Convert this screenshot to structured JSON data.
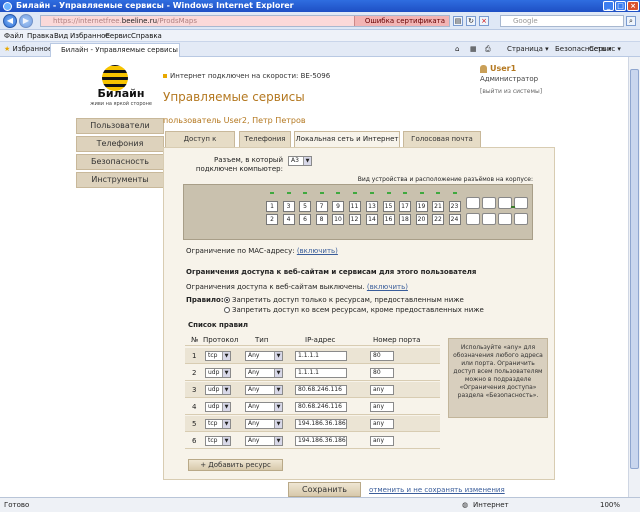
{
  "window": {
    "title": "Билайн - Управляемые сервисы - Windows Internet Explorer"
  },
  "browser": {
    "address_dim": "https://internetfree.",
    "address_host": "beeline.ru",
    "address_tail": "/ProdsMaps",
    "cert_error": "Ошибка сертификата",
    "search_placeholder": "Google",
    "menu": [
      "Файл",
      "Правка",
      "Вид",
      "Избранное",
      "Сервис",
      "Справка"
    ],
    "favorites": "Избранное",
    "tab_title": "Билайн - Управляемые сервисы",
    "tools": {
      "page": "Страница",
      "security": "Безопасность",
      "service": "Сервис"
    },
    "status_left": "Готово",
    "status_zone": "Интернет",
    "zoom": "100%"
  },
  "header": {
    "brand": "Билайн",
    "slogan": "живи на яркой стороне",
    "connection": "Интернет подключен на скорости: BE-5096",
    "title": "Управляемые сервисы",
    "user": {
      "name": "User1",
      "role": "Администратор",
      "logout": "[выйти из системы]"
    }
  },
  "nav": [
    "Пользователи",
    "Телефония",
    "Безопасность",
    "Инструменты"
  ],
  "user_label": "пользователь User2, Петр Петров",
  "tabs": [
    "Доступ к аккаунту",
    "Телефония",
    "Локальная сеть и Интернет",
    "Голосовая почта"
  ],
  "active_tab": 2,
  "port": {
    "label": "Разъем, в который подключен компьютер:",
    "value": "A3",
    "device_caption": "Вид устройства и расположение разъёмов на корпусе:",
    "top_left": [
      "1",
      "3",
      "5",
      "7",
      "9",
      "11"
    ],
    "bottom_left": [
      "2",
      "4",
      "6",
      "8",
      "10",
      "12"
    ],
    "top_right": [
      "13",
      "15",
      "17",
      "19",
      "21",
      "23"
    ],
    "bottom_right": [
      "14",
      "16",
      "18",
      "20",
      "22",
      "24"
    ]
  },
  "mac": {
    "label": "Ограничение по MAC-адресу:",
    "link": "(включить)"
  },
  "access": {
    "heading": "Ограничения доступа к веб-сайтам и сервисам для этого пользователя",
    "status": "Ограничения доступа к веб-сайтам выключены.",
    "enable_link": "(включить)",
    "rule_label": "Правило:",
    "option1": "Запретить доступ только к ресурсам, предоставленным ниже",
    "option2": "Запретить доступ ко всем ресурсам, кроме предоставленных ниже"
  },
  "rules": {
    "title": "Список правил",
    "columns": [
      "№",
      "Протокол",
      "Тип",
      "IP-адрес",
      "Номер порта"
    ],
    "rows": [
      {
        "n": "1",
        "proto": "tcp",
        "type": "Any",
        "ip": "1.1.1.1",
        "port": "80"
      },
      {
        "n": "2",
        "proto": "udp",
        "type": "Any",
        "ip": "1.1.1.1",
        "port": "80"
      },
      {
        "n": "3",
        "proto": "udp",
        "type": "Any",
        "ip": "80.68.246.116",
        "port": "any"
      },
      {
        "n": "4",
        "proto": "udp",
        "type": "Any",
        "ip": "80.68.246.116",
        "port": "any"
      },
      {
        "n": "5",
        "proto": "tcp",
        "type": "Any",
        "ip": "194.186.36.186",
        "port": "any"
      },
      {
        "n": "6",
        "proto": "tcp",
        "type": "Any",
        "ip": "194.186.36.186",
        "port": "any"
      }
    ]
  },
  "help": "Используйте «any» для обозначения любого адреса или порта. Ограничить доступ всем пользователям можно в подразделе «Ограничения доступа» раздела «Безопасность».",
  "add_button": "+ Добавить ресурс",
  "save_button": "Сохранить",
  "cancel_link": "отменить и не сохранять изменения"
}
